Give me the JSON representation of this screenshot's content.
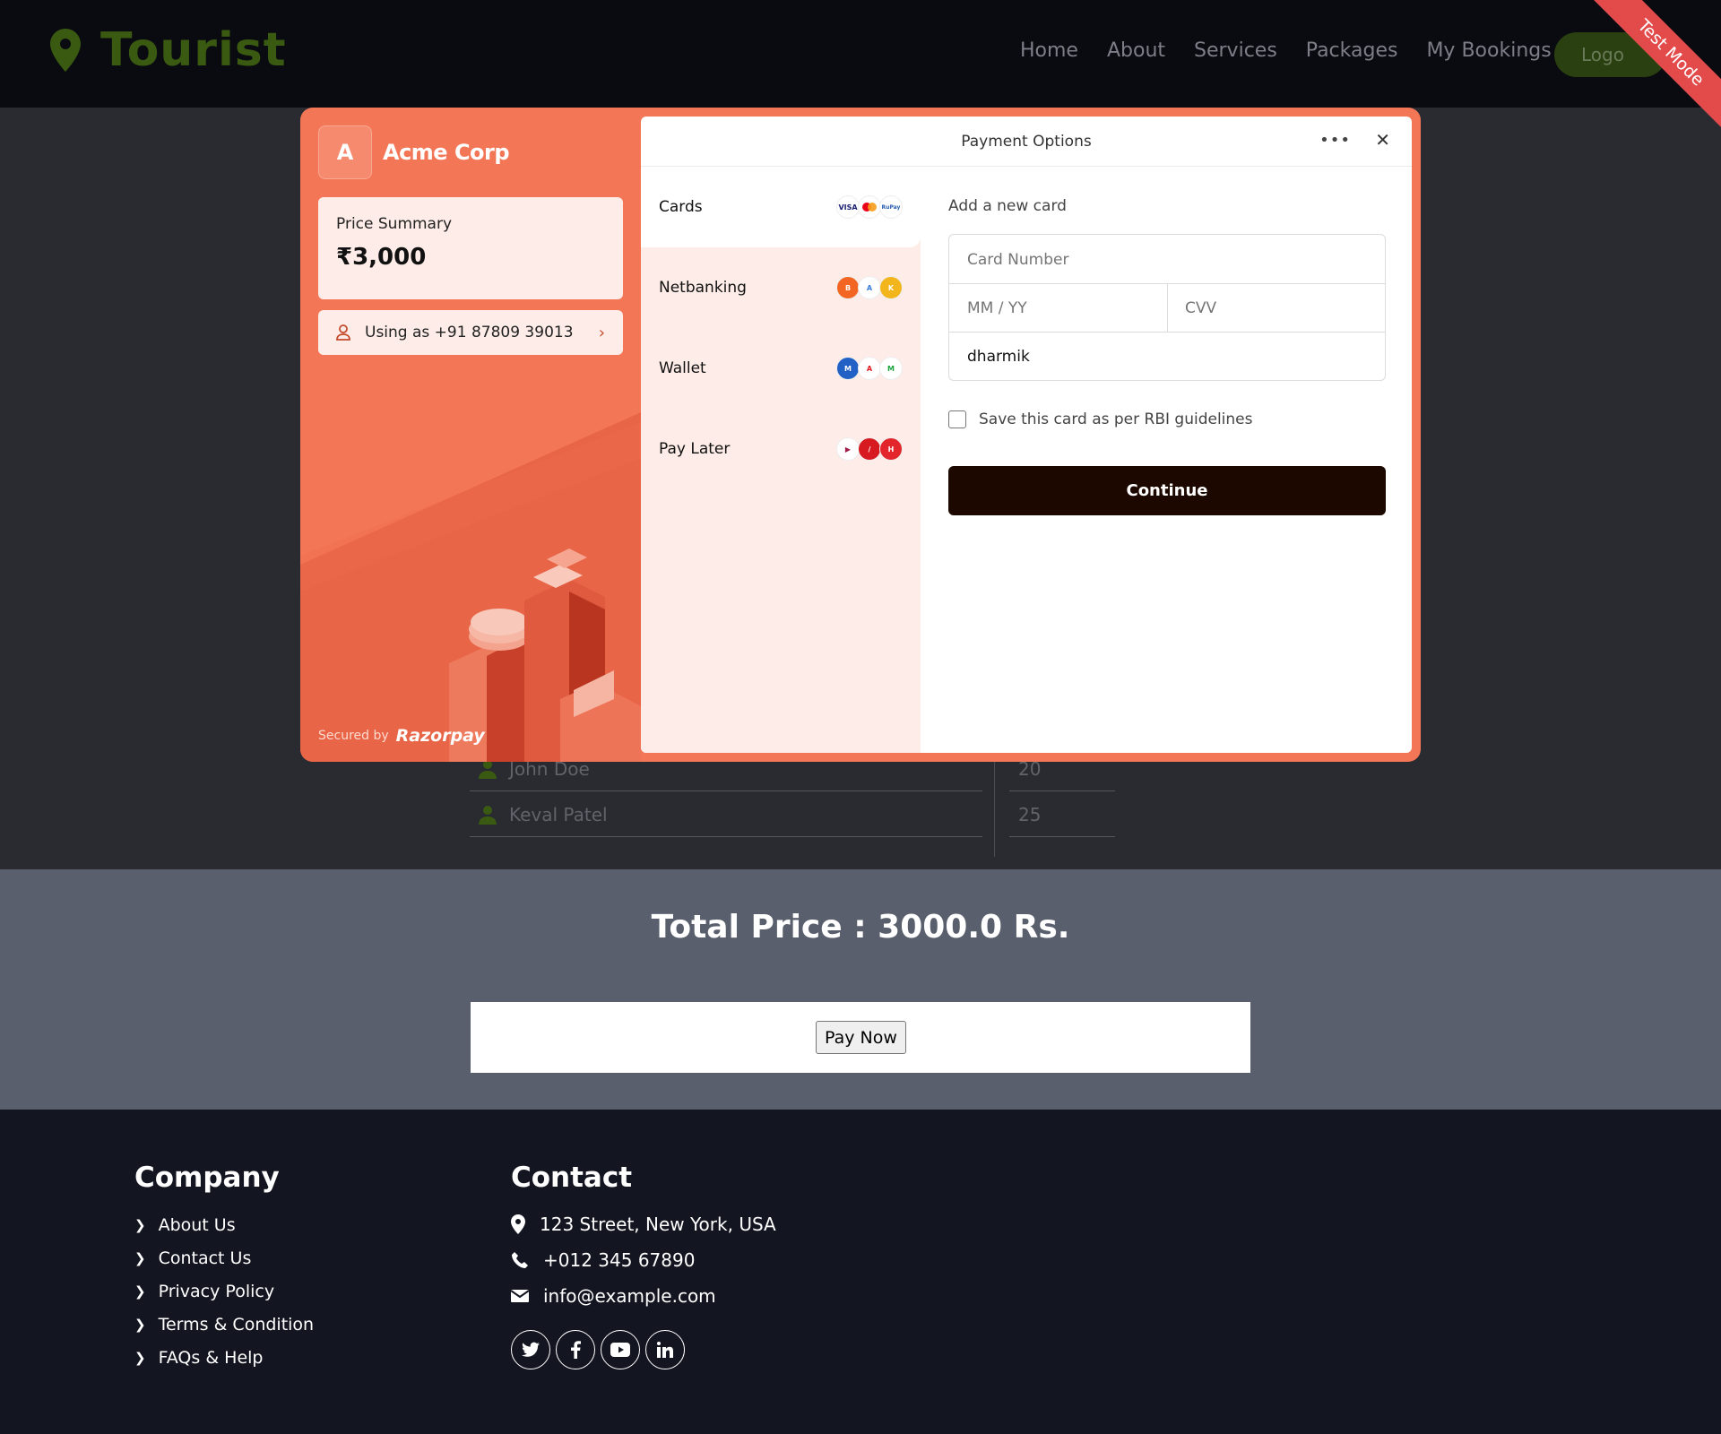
{
  "nav": {
    "brand": "Tourist",
    "links": [
      "Home",
      "About",
      "Services",
      "Packages",
      "My Bookings"
    ],
    "logout": "Logo",
    "ribbon": "Test Mode"
  },
  "attendees": [
    {
      "name": "John Doe",
      "age": "20"
    },
    {
      "name": "Keval Patel",
      "age": "25"
    }
  ],
  "total_price": "Total Price : 3000.0 Rs.",
  "pay_now": "Pay Now",
  "footer": {
    "company_title": "Company",
    "company_links": [
      "About Us",
      "Contact Us",
      "Privacy Policy",
      "Terms & Condition",
      "FAQs & Help"
    ],
    "contact_title": "Contact",
    "address": "123 Street, New York, USA",
    "phone": "+012 345 67890",
    "email": "info@example.com",
    "socials": [
      "twitter-icon",
      "facebook-icon",
      "youtube-icon",
      "linkedin-icon"
    ]
  },
  "razorpay": {
    "merchant_initial": "A",
    "merchant_name": "Acme Corp",
    "price_summary_label": "Price Summary",
    "price_summary_amount": "₹3,000",
    "using_as": "Using as +91 87809 39013",
    "secured_by": "Secured by",
    "secured_brand": "Razorpay",
    "header_title": "Payment Options",
    "methods": [
      {
        "label": "Cards",
        "icons": [
          "VISA",
          "MC",
          "RuPay"
        ]
      },
      {
        "label": "Netbanking",
        "icons": [
          "B",
          "A",
          "K"
        ]
      },
      {
        "label": "Wallet",
        "icons": [
          "M",
          "A",
          "M"
        ]
      },
      {
        "label": "Pay Later",
        "icons": [
          "▶",
          "/",
          "H"
        ]
      }
    ],
    "form_title": "Add a new card",
    "card_number_placeholder": "Card Number",
    "expiry_placeholder": "MM / YY",
    "cvv_placeholder": "CVV",
    "name_value": "dharmik",
    "save_card_label": "Save this card as per RBI guidelines",
    "continue_label": "Continue"
  },
  "colors": {
    "razorpay_accent": "#f37757",
    "brand_green": "#3a5a12",
    "continue_bg": "#1d0800"
  }
}
